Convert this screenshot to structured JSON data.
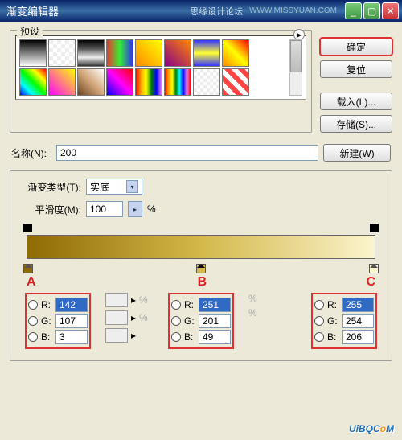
{
  "titlebar": {
    "title": "渐变编辑器",
    "brand": "思缘设计论坛",
    "url": "WWW.MISSYUAN.COM"
  },
  "presets": {
    "legend": "预设",
    "swatches": [
      "g1",
      "g2",
      "g3",
      "g4",
      "g5",
      "g6",
      "g7",
      "g8",
      "g9",
      "g10",
      "g11",
      "g12",
      "g13",
      "g14",
      "g15",
      "g16"
    ]
  },
  "buttons": {
    "ok": "确定",
    "reset": "复位",
    "load": "载入(L)...",
    "save": "存储(S)...",
    "new": "新建(W)"
  },
  "name": {
    "label": "名称(N):",
    "value": "200"
  },
  "gradient": {
    "type_label": "渐变类型(T):",
    "type_value": "实底",
    "smooth_label": "平滑度(M):",
    "smooth_value": "100",
    "smooth_unit": "%"
  },
  "markers": {
    "a": "A",
    "b": "B",
    "c": "C"
  },
  "rgb": {
    "r_label": "R:",
    "g_label": "G:",
    "b_label": "B:",
    "pct": "%",
    "A": {
      "r": "142",
      "g": "107",
      "b": "3"
    },
    "B": {
      "r": "251",
      "g": "201",
      "b": "49"
    },
    "C": {
      "r": "255",
      "g": "254",
      "b": "206"
    }
  },
  "footer": {
    "pre": "UiB",
    "q": "Q",
    ".": ".",
    "c": "C",
    "o": "o",
    "m": "M"
  }
}
